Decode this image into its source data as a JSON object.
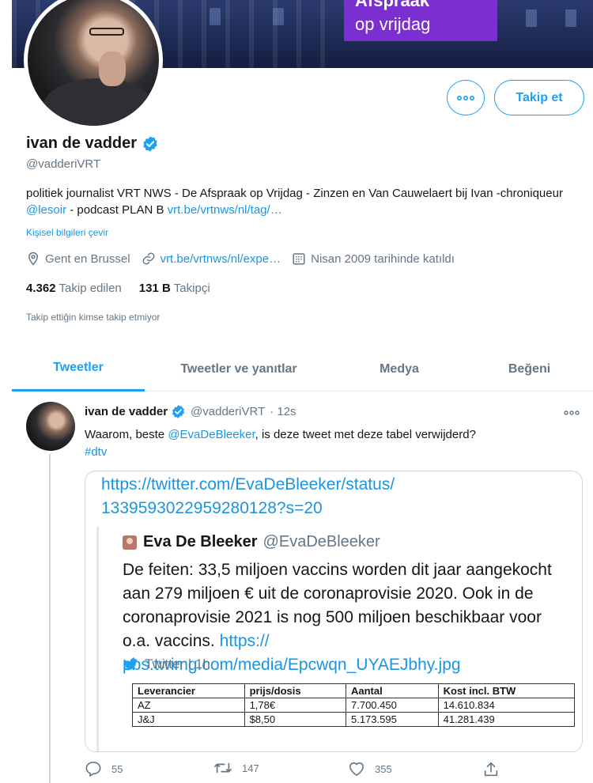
{
  "banner": {
    "promo_line1": "Afspraak",
    "promo_line2": "op vrijdag",
    "colors": {
      "promo": "#7b2fd0",
      "sky": "#1d2a55"
    }
  },
  "profile": {
    "name": "ivan de vadder",
    "handle": "@vadderiVRT",
    "more_icon": "ellipsis-icon",
    "follow_label": "Takip et",
    "bio_text_1": "politiek journalist VRT NWS - De Afspraak op Vrijdag - Zinzen en Van Cauwelaert bij Ivan -chroniqueur ",
    "bio_mention": "@lesoir",
    "bio_text_2": " - podcast PLAN B ",
    "bio_link": "vrt.be/vrtnws/nl/tag/…",
    "translate_label": "Kişisel bilgileri çevir",
    "location": "Gent en Brussel",
    "website": "vrt.be/vrtnws/nl/expe…",
    "joined": "Nisan 2009 tarihinde katıldı",
    "following_count": "4.362",
    "following_label": "Takip edilen",
    "followers_count": "131 B",
    "followers_label": "Takipçi",
    "no_mutual": "Takip ettiğin kimse takip etmiyor"
  },
  "tabs": [
    {
      "label": "Tweetler",
      "active": true
    },
    {
      "label": "Tweetler ve yanıtlar",
      "active": false
    },
    {
      "label": "Medya",
      "active": false
    },
    {
      "label": "Beğeni",
      "active": false
    }
  ],
  "tweet": {
    "name": "ivan de vadder",
    "handle": "@vadderiVRT",
    "time": "· 12s",
    "text_1": "Waarom, beste ",
    "mention": "@EvaDeBleeker",
    "text_2": ", is deze tweet met deze tabel verwijderd?",
    "hashtag": "#dtv",
    "card_url_1": "https://twitter.com/EvaDeBleeker/status/",
    "card_url_2": "1339593022959280128?s=20",
    "quote": {
      "name": "Eva De Bleeker",
      "handle": "@EvaDeBleeker",
      "text": "De feiten:  33,5 miljoen vaccins worden dit jaar aangekocht aan 279 miljoen € uit de coronaprovisie 2020. Ook in de coronaprovisie 2021 is nog 500 miljoen beschikbaar voor o.a. vaccins. ",
      "link_1": "https://",
      "link_2": "pbs.twimg.com/media/Epcwqn_UYAEJbhy.jpg",
      "source": "Twitter | 1h",
      "table": {
        "headers": [
          "Leverancier",
          "prijs/dosis",
          "Aantal",
          "Kost incl. BTW"
        ],
        "rows": [
          [
            "AZ",
            "1,78€",
            "7.700.450",
            "14.610.834"
          ],
          [
            "J&J",
            "$8,50",
            "5.173.595",
            "41.281.439"
          ]
        ]
      }
    },
    "actions": {
      "reply_count": "55",
      "retweet_count": "147",
      "like_count": "355"
    }
  },
  "colors": {
    "accent": "#1da1f2",
    "link": "#1b95e0",
    "muted": "#657786",
    "text": "#14171a"
  }
}
